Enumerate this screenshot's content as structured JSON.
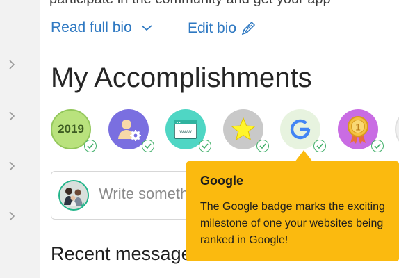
{
  "profile": {
    "top_cut_text": "participate in the community and get your app",
    "read_bio_label": "Read full bio",
    "edit_bio_label": "Edit bio"
  },
  "accomplishments": {
    "title": "My Accomplishments",
    "badges": [
      {
        "icon": "year-2019-icon",
        "text": "2019",
        "color": "#b9e27d",
        "earned": true
      },
      {
        "icon": "user-settings-icon",
        "color": "#7a6fe0",
        "earned": true
      },
      {
        "icon": "website-icon",
        "color": "#4fd6c4",
        "earned": true
      },
      {
        "icon": "star-icon",
        "color": "#c9c9c9",
        "earned": true
      },
      {
        "icon": "google-g-icon",
        "color": "#e7f3df",
        "earned": true
      },
      {
        "icon": "first-place-medal-icon",
        "color": "#c96ce3",
        "earned": true
      }
    ]
  },
  "composer": {
    "placeholder": "Write something..."
  },
  "messages": {
    "title": "Recent messages"
  },
  "tooltip": {
    "title": "Google",
    "body": "The Google badge marks the exciting milestone of one your websites being ranked in Google!"
  }
}
